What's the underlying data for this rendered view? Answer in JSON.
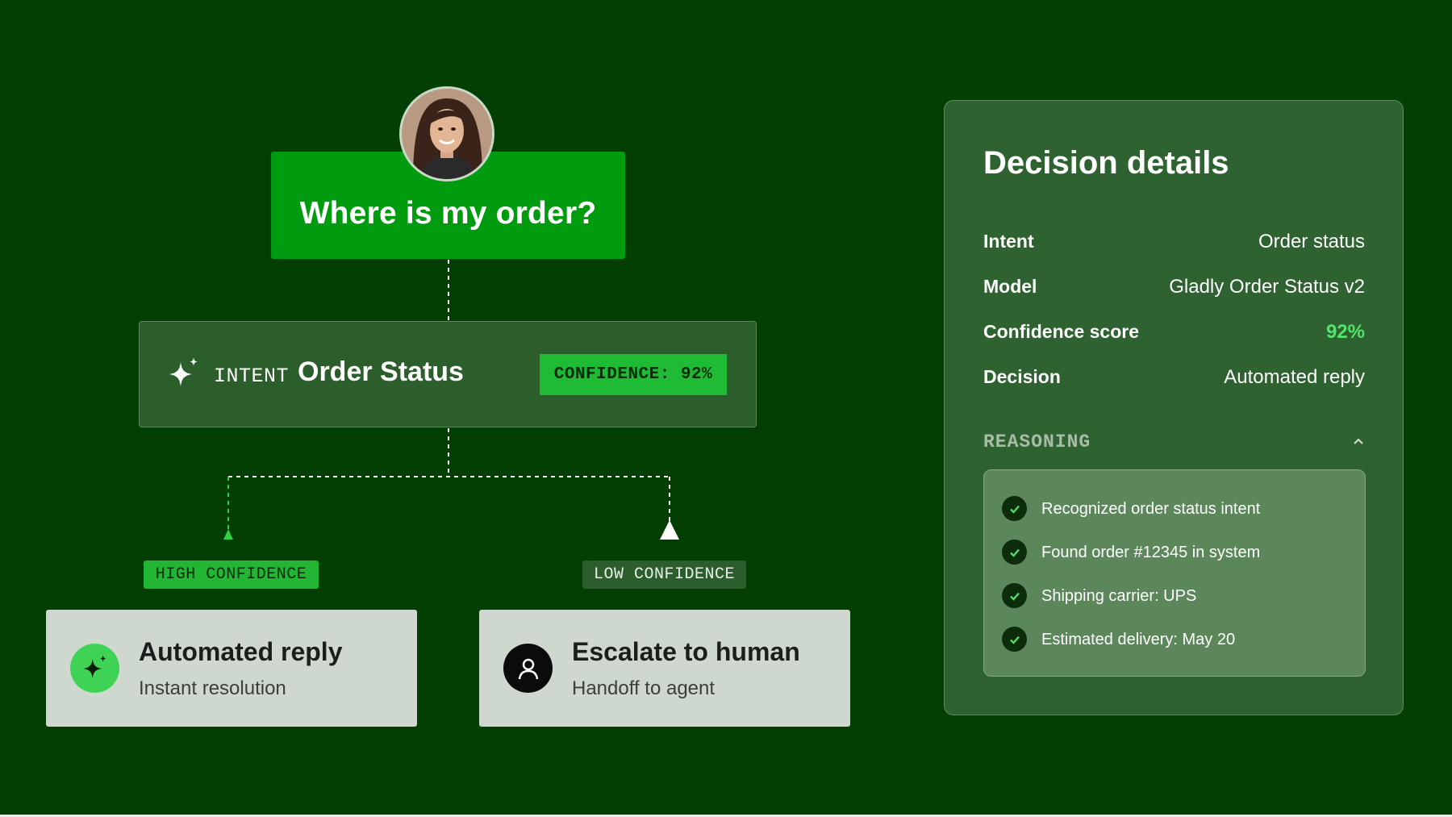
{
  "question": {
    "text": "Where is my order?"
  },
  "intent": {
    "label": "INTENT",
    "value": "Order Status",
    "confidence_badge": "CONFIDENCE: 92%"
  },
  "branches": {
    "high": {
      "tag": "HIGH CONFIDENCE",
      "title": "Automated reply",
      "subtitle": "Instant resolution"
    },
    "low": {
      "tag": "LOW CONFIDENCE",
      "title": "Escalate to human",
      "subtitle": "Handoff to agent"
    }
  },
  "details": {
    "title": "Decision details",
    "rows": [
      {
        "key": "Intent",
        "value": "Order status"
      },
      {
        "key": "Model",
        "value": "Gladly Order Status v2"
      },
      {
        "key": "Confidence score",
        "value": "92%"
      },
      {
        "key": "Decision",
        "value": "Automated reply"
      }
    ],
    "reasoning_label": "REASONING",
    "reasons": [
      "Recognized order status intent",
      "Found order #12345 in system",
      "Shipping carrier: UPS",
      "Estimated delivery: May 20"
    ]
  },
  "colors": {
    "background": "#033f03",
    "question_green": "#009b0e",
    "accent_green": "#1fbb34",
    "panel": "#2e6230",
    "card": "#cfd8cf"
  },
  "icons": {
    "intent": "sparkle-icon",
    "automated": "sparkle-icon",
    "human": "user-icon",
    "check": "check-icon",
    "reasoning_toggle": "chevron-up-icon"
  }
}
